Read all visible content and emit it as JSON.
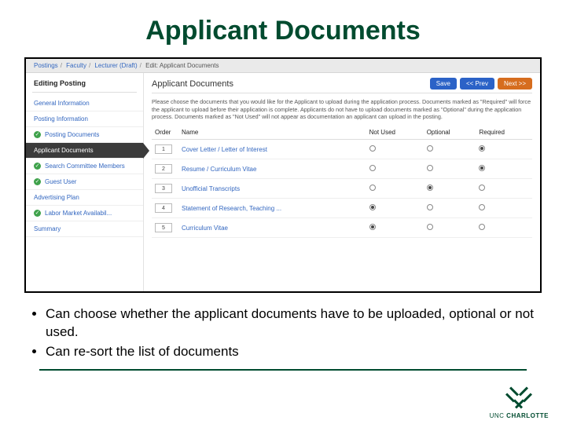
{
  "title": "Applicant Documents",
  "breadcrumb": {
    "p1": "Postings",
    "p2": "Faculty",
    "p3": "Lecturer (Draft)",
    "p4": "Edit: Applicant Documents"
  },
  "sidebar": {
    "title": "Editing Posting",
    "items": [
      {
        "label": "General Information",
        "check": false
      },
      {
        "label": "Posting Information",
        "check": false
      },
      {
        "label": "Posting Documents",
        "check": true
      },
      {
        "label": "Applicant Documents",
        "check": false,
        "active": true
      },
      {
        "label": "Search Committee Members",
        "check": true
      },
      {
        "label": "Guest User",
        "check": true
      },
      {
        "label": "Advertising Plan",
        "check": false
      },
      {
        "label": "Labor Market Availabil...",
        "check": true
      },
      {
        "label": "Summary",
        "check": false
      }
    ]
  },
  "panel": {
    "title": "Applicant Documents",
    "save": "Save",
    "prev": "<< Prev",
    "next": "Next >>",
    "instructions": "Please choose the documents that you would like for the Applicant to upload during the application process. Documents marked as \"Required\" will force the applicant to upload before their application is complete. Applicants do not have to upload documents marked as \"Optional\" during the application process. Documents marked as \"Not Used\" will not appear as documentation an applicant can upload in the posting.",
    "headers": {
      "order": "Order",
      "name": "Name",
      "notused": "Not Used",
      "optional": "Optional",
      "required": "Required"
    },
    "rows": [
      {
        "order": "1",
        "name": "Cover Letter / Letter of Interest",
        "sel": "required"
      },
      {
        "order": "2",
        "name": "Resume / Curriculum Vitae",
        "sel": "required"
      },
      {
        "order": "3",
        "name": "Unofficial Transcripts",
        "sel": "optional"
      },
      {
        "order": "4",
        "name": "Statement of Research, Teaching ...",
        "sel": "notused"
      },
      {
        "order": "5",
        "name": "Curriculum Vitae",
        "sel": "notused"
      }
    ]
  },
  "bullets": {
    "b1": "Can choose whether the applicant documents have to be uploaded, optional or not used.",
    "b2": "Can re-sort the list of documents"
  },
  "logo": {
    "text_plain": "UNC ",
    "text_bold": "CHARLOTTE"
  }
}
